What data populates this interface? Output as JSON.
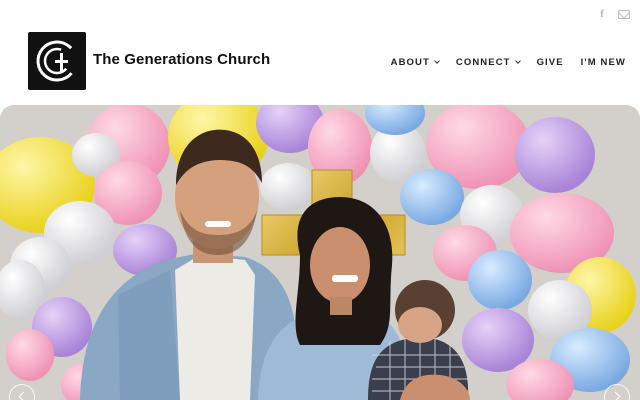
{
  "site": {
    "title": "The Generations Church",
    "logo_icon": "church-logo-icon"
  },
  "social": {
    "facebook_glyph": "f",
    "icons": [
      "facebook-icon",
      "email-icon"
    ]
  },
  "nav": {
    "items": [
      {
        "label": "ABOUT",
        "has_dropdown": true
      },
      {
        "label": "CONNECT",
        "has_dropdown": true
      },
      {
        "label": "GIVE",
        "has_dropdown": false
      },
      {
        "label": "I'M NEW",
        "has_dropdown": false
      }
    ]
  },
  "hero": {
    "image_icon": "hero-photo-balloons",
    "controls": [
      "previous-slide-button",
      "next-slide-button"
    ]
  },
  "colors": {
    "text": "#111111",
    "nav_text": "#222222",
    "social_icon": "#bbbbbb",
    "background": "#ffffff"
  }
}
